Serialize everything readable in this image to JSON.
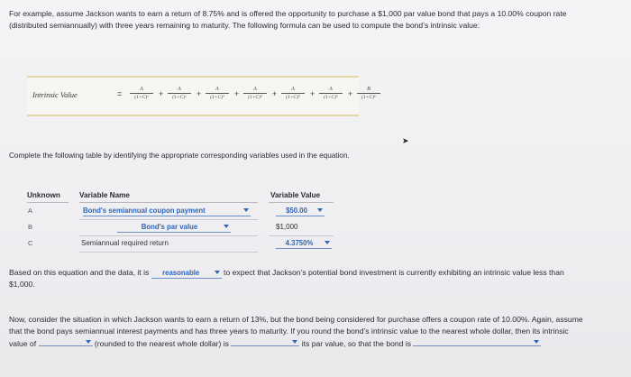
{
  "intro": "For example, assume Jackson wants to earn a return of 8.75% and is offered the opportunity to purchase a $1,000 par value bond that pays a 10.00% coupon rate (distributed semiannually) with three years remaining to maturity. The following formula can be used to compute the bond’s intrinsic value:",
  "formula": {
    "label": "Intrinsic Value",
    "equals": "=",
    "plus": "+",
    "terms": [
      {
        "num": "A",
        "den": "(1+C)¹"
      },
      {
        "num": "A",
        "den": "(1+C)²"
      },
      {
        "num": "A",
        "den": "(1+C)³"
      },
      {
        "num": "A",
        "den": "(1+C)⁴"
      },
      {
        "num": "A",
        "den": "(1+C)⁵"
      },
      {
        "num": "A",
        "den": "(1+C)⁶"
      },
      {
        "num": "B",
        "den": "(1+C)⁶"
      }
    ]
  },
  "instruction": "Complete the following table by identifying the appropriate corresponding variables used in the equation.",
  "table": {
    "headers": {
      "unknown": "Unknown",
      "name": "Variable Name",
      "value": "Variable Value"
    },
    "rows": [
      {
        "letter": "A",
        "name": "Bond's semiannual coupon payment",
        "name_is_dropdown": true,
        "value": "$50.00",
        "value_is_dropdown": true
      },
      {
        "letter": "B",
        "name": "Bond's par value",
        "name_is_dropdown": true,
        "value": "$1,000",
        "value_is_dropdown": false
      },
      {
        "letter": "C",
        "name": "Semiannual required return",
        "name_is_dropdown": false,
        "value": "4.3750%",
        "value_is_dropdown": true
      }
    ]
  },
  "based": {
    "before": "Based on this equation and the data, it is ",
    "select": "reasonable",
    "after": " to expect that Jackson’s potential bond investment is currently exhibiting an intrinsic value less than $1,000."
  },
  "now": {
    "part1": "Now, consider the situation in which Jackson wants to earn a return of 13%, but the bond being considered for purchase offers a coupon rate of 10.00%. Again, assume that the bond pays semiannual interest payments and has three years to maturity. If you round the bond’s intrinsic value to the nearest whole dollar, then its intrinsic value of ",
    "part2": " (rounded to the nearest whole dollar) is ",
    "part3": " its par value, so that the bond is "
  },
  "colors": {
    "link_blue": "#2f64b8",
    "rule_gold": "#e2d8a6"
  }
}
